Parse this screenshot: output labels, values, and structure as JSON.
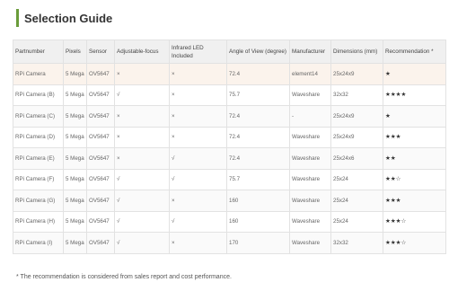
{
  "header": {
    "title": "Selection Guide"
  },
  "table": {
    "columns": [
      "Partnumber",
      "Pixels",
      "Sensor",
      "Adjustable-focus",
      "Infrared LED Included",
      "Angle of View (degree)",
      "Manufacturer",
      "Dimensions (mm)",
      "Recommendation *"
    ],
    "rows": [
      [
        "RPi Camera",
        "5 Mega",
        "OV5647",
        "×",
        "×",
        "72.4",
        "element14",
        "25x24x9",
        "★"
      ],
      [
        "RPi Camera (B)",
        "5 Mega",
        "OV5647",
        "√",
        "×",
        "75.7",
        "Waveshare",
        "32x32",
        "★★★★"
      ],
      [
        "RPi Camera (C)",
        "5 Mega",
        "OV5647",
        "×",
        "×",
        "72.4",
        "-",
        "25x24x9",
        "★"
      ],
      [
        "RPi Camera (D)",
        "5 Mega",
        "OV5647",
        "×",
        "×",
        "72.4",
        "Waveshare",
        "25x24x9",
        "★★★"
      ],
      [
        "RPi Camera (E)",
        "5 Mega",
        "OV5647",
        "×",
        "√",
        "72.4",
        "Waveshare",
        "25x24x6",
        "★★"
      ],
      [
        "RPi Camera (F)",
        "5 Mega",
        "OV5647",
        "√",
        "√",
        "75.7",
        "Waveshare",
        "25x24",
        "★★☆"
      ],
      [
        "RPi Camera (G)",
        "5 Mega",
        "OV5647",
        "√",
        "×",
        "160",
        "Waveshare",
        "25x24",
        "★★★"
      ],
      [
        "RPi Camera (H)",
        "5 Mega",
        "OV5647",
        "√",
        "√",
        "160",
        "Waveshare",
        "25x24",
        "★★★☆"
      ],
      [
        "RPi Camera (I)",
        "5 Mega",
        "OV5647",
        "√",
        "×",
        "170",
        "Waveshare",
        "32x32",
        "★★★☆"
      ]
    ]
  },
  "footnote": "* The recommendation is considered from sales report and cost performance.",
  "colors": {
    "accent": "#6a9c3a",
    "header_bg": "#f0f0f0",
    "highlight_row": "#fbf3ec"
  }
}
